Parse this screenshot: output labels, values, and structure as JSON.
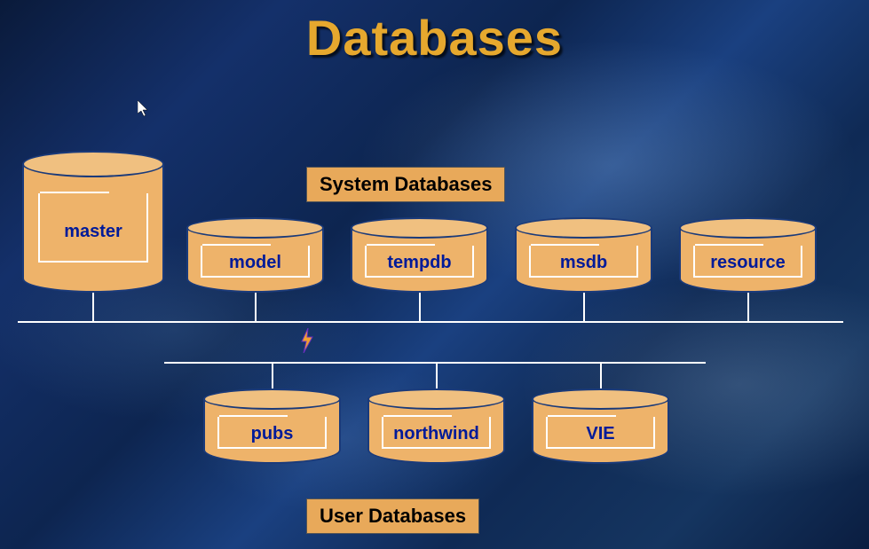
{
  "title": "Databases",
  "sections": {
    "system": "System Databases",
    "user": "User Databases"
  },
  "system_dbs": {
    "master": "master",
    "model": "model",
    "tempdb": "tempdb",
    "msdb": "msdb",
    "resource": "resource"
  },
  "user_dbs": {
    "pubs": "pubs",
    "northwind": "northwind",
    "vie": "VIE"
  },
  "colors": {
    "title": "#e6a82e",
    "cylinder_fill": "#eeb36a",
    "cylinder_top": "#f0c080",
    "cylinder_stroke": "#1a3a7a",
    "label_bg": "#e8a95a",
    "db_text": "#001a99"
  }
}
